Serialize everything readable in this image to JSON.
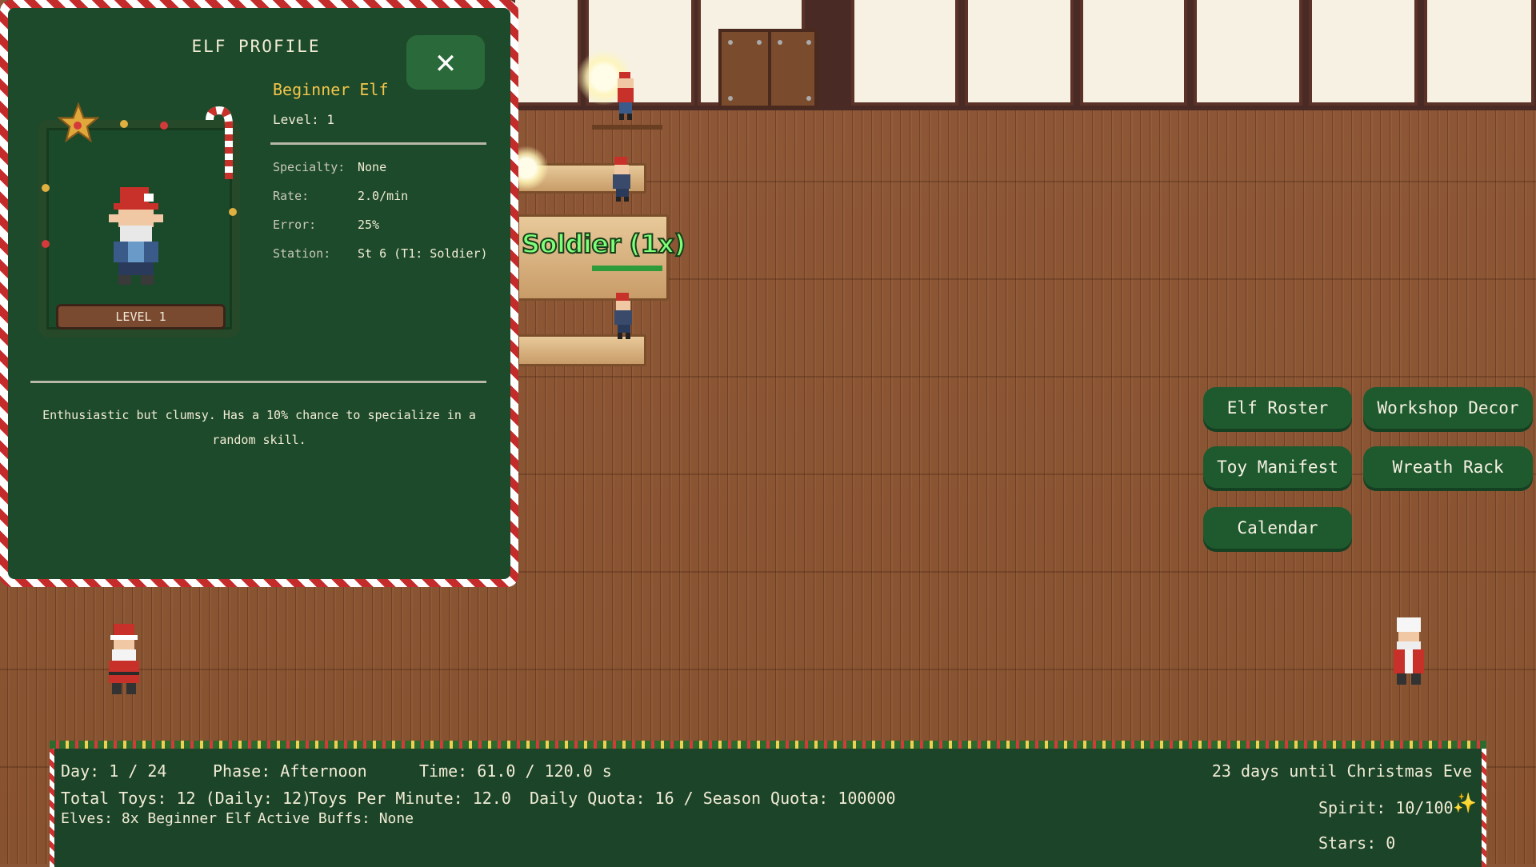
{
  "profile": {
    "title": "ELF PROFILE",
    "close_icon": "close-icon",
    "name": "Beginner Elf",
    "level_line": "Level: 1",
    "portrait_badge": "LEVEL 1",
    "stats": [
      {
        "label": "Specialty:",
        "value": "None"
      },
      {
        "label": "Rate:",
        "value": "2.0/min"
      },
      {
        "label": "Error:",
        "value": "25%"
      },
      {
        "label": "Station:",
        "value": "St 6 (T1: Soldier)"
      }
    ],
    "description": "Enthusiastic but clumsy. Has a 10% chance to specialize in a random skill."
  },
  "workshop": {
    "station_label": "Soldier (1x)"
  },
  "menu": {
    "elf_roster": "Elf Roster",
    "workshop_decor": "Workshop Decor",
    "toy_manifest": "Toy Manifest",
    "wreath_rack": "Wreath Rack",
    "calendar": "Calendar"
  },
  "hud": {
    "day": "Day: 1 / 24",
    "phase": "Phase: Afternoon",
    "time": "Time: 61.0 / 120.0 s",
    "countdown": "23 days until Christmas Eve",
    "total_toys": "Total Toys: 12 (Daily: 12)",
    "toys_per_minute": "Toys Per Minute: 12.0",
    "quota": "Daily Quota: 16 / Season Quota: 100000",
    "elves": "Elves: 8x Beginner Elf",
    "buffs": "Active Buffs:  None",
    "spirit": "Spirit: 10/100",
    "stars": "Stars: 0",
    "sparkle_icon": "sparkle-icon"
  },
  "colors": {
    "panel_green": "#1d4a2a",
    "button_green": "#1f5a2f",
    "accent_gold": "#f3c64a",
    "candy_red": "#c42b2b",
    "label_green": "#7dff7a"
  }
}
